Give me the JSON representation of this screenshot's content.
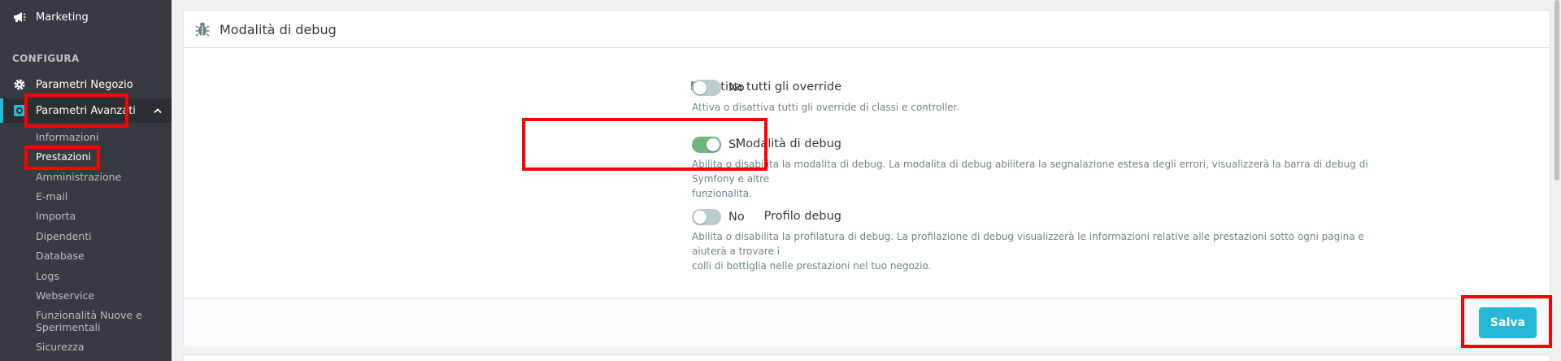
{
  "sidebar": {
    "marketing": "Marketing",
    "section_title": "CONFIGURA",
    "shop_params": "Parametri Negozio",
    "advanced_params": "Parametri Avanzati",
    "sub_items": [
      "Informazioni",
      "Prestazioni",
      "Amministrazione",
      "E-mail",
      "Importa",
      "Dipendenti",
      "Database",
      "Logs",
      "Webservice",
      "Funzionalità Nuove e",
      "Sperimentali",
      "Sicurezza"
    ]
  },
  "panel": {
    "title": "Modalità di debug",
    "icon": "bug-icon",
    "fields": [
      {
        "label": "Disattiva tutti gli override",
        "state": "No",
        "help": "Attiva o disattiva tutti gli override di classi e controller."
      },
      {
        "label": "Modalità di debug",
        "state": "Sì",
        "help_line1": "Abilita o disabilita la modalita di debug. La modalita di debug abilitera la segnalazione estesa degli errori, visualizzerà la barra di debug di Symfony e altre",
        "help_line2": "funzionalita."
      },
      {
        "label": "Profilo debug",
        "state": "No",
        "help_line1": "Abilita o disabilita la profilatura di debug. La profilazione di debug visualizzerà le informazioni relative alle prestazioni sotto ogni pagina e aiuterà a trovare i",
        "help_line2": "colli di bottiglia nelle prestazioni nel tuo negozio."
      }
    ],
    "save_label": "Salva"
  },
  "colors": {
    "sidebar_bg": "#363a41",
    "accent": "#25b9d7",
    "switch_on": "#70b580",
    "switch_off": "#bbcdd2",
    "highlight": "#ff0000"
  }
}
